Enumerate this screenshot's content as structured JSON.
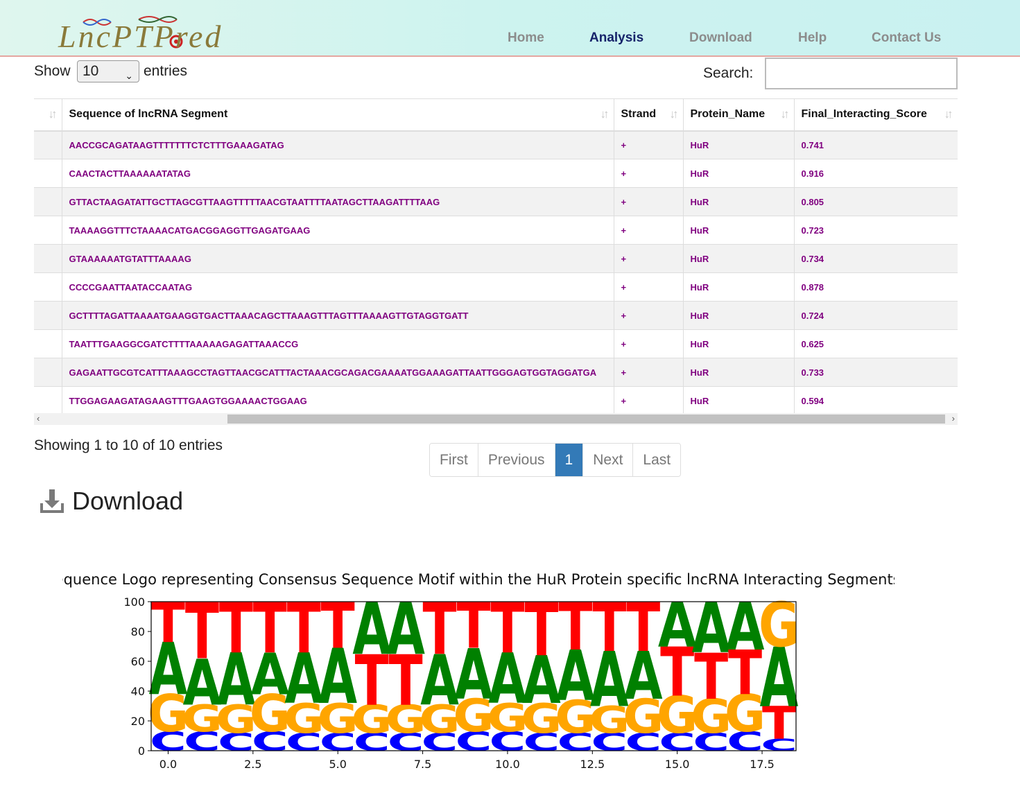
{
  "header": {
    "logo_text": "LncPTPred",
    "nav": [
      "Home",
      "Analysis",
      "Download",
      "Help",
      "Contact Us"
    ],
    "active": "Analysis"
  },
  "controls": {
    "show_label": "Show",
    "show_value": "10",
    "entries_label": "entries",
    "search_label": "Search:",
    "search_value": ""
  },
  "table": {
    "columns": [
      "Sequence of lncRNA Segment",
      "Strand",
      "Protein_Name",
      "Final_Interacting_Score"
    ],
    "rows": [
      {
        "seq": "AACCGCAGATAAGTTTTTTTCTCTTTGAAAGATAG",
        "strand": "+",
        "protein": "HuR",
        "score": "0.741"
      },
      {
        "seq": "CAACTACTTAAAAAATATAG",
        "strand": "+",
        "protein": "HuR",
        "score": "0.916"
      },
      {
        "seq": "GTTACTAAGATATTGCTTAGCGTTAAGTTTTTAACGTAATTTTAATAGCTTAAGATTTTAAG",
        "strand": "+",
        "protein": "HuR",
        "score": "0.805"
      },
      {
        "seq": "TAAAAGGTTTCTAAAACATGACGGAGGTTGAGATGAAG",
        "strand": "+",
        "protein": "HuR",
        "score": "0.723"
      },
      {
        "seq": "GTAAAAAATGTATTTAAAAG",
        "strand": "+",
        "protein": "HuR",
        "score": "0.734"
      },
      {
        "seq": "CCCCGAATTAATACCAATAG",
        "strand": "+",
        "protein": "HuR",
        "score": "0.878"
      },
      {
        "seq": "GCTTTTAGATTAAAATGAAGGTGACTTAAACAGCTTAAAGTTTAGTTTAAAAGTTGTAGGTGATT",
        "strand": "+",
        "protein": "HuR",
        "score": "0.724"
      },
      {
        "seq": "TAATTTGAAGGCGATCTTTTAAAAAGAGATTAAACCG",
        "strand": "+",
        "protein": "HuR",
        "score": "0.625"
      },
      {
        "seq": "GAGAATTGCGTCATTTAAAGCCTAGTTAACGCATTTACTAAACGCAGACGAAAATGGAAAGATTAATTGGGAGTGGTAGGATGA",
        "strand": "+",
        "protein": "HuR",
        "score": "0.733"
      },
      {
        "seq": "TTGGAGAAGATAGAAGTTTGAAGTGGAAAACTGGAAG",
        "strand": "+",
        "protein": "HuR",
        "score": "0.594"
      }
    ]
  },
  "footer": {
    "info": "Showing 1 to 10 of 10 entries",
    "pager": [
      "First",
      "Previous",
      "1",
      "Next",
      "Last"
    ],
    "current_page": "1",
    "download_label": "Download"
  },
  "chart_data": {
    "type": "sequence-logo",
    "title": "Sequence Logo representing Consensus Sequence Motif within the HuR Protein specific lncRNA Interacting Segments",
    "xlabel": "",
    "ylabel": "",
    "ylim": [
      0,
      100
    ],
    "yticks": [
      0,
      20,
      40,
      60,
      80,
      100
    ],
    "xticks": [
      0.0,
      2.5,
      5.0,
      7.5,
      10.0,
      12.5,
      15.0,
      17.5
    ],
    "xtick_labels": [
      "0.0",
      "2.5",
      "5.0",
      "7.5",
      "10.0",
      "12.5",
      "15.0",
      "17.5"
    ],
    "colors": {
      "C": "#0000ff",
      "G": "#ffa500",
      "A": "#008000",
      "T": "#ff0000"
    },
    "positions": [
      {
        "x": 0,
        "stack": [
          [
            "C",
            13
          ],
          [
            "G",
            25
          ],
          [
            "A",
            35
          ],
          [
            "T",
            27
          ]
        ]
      },
      {
        "x": 1,
        "stack": [
          [
            "C",
            13
          ],
          [
            "G",
            18
          ],
          [
            "A",
            31
          ],
          [
            "T",
            38
          ]
        ]
      },
      {
        "x": 2,
        "stack": [
          [
            "C",
            12
          ],
          [
            "G",
            19
          ],
          [
            "A",
            35
          ],
          [
            "T",
            34
          ]
        ]
      },
      {
        "x": 3,
        "stack": [
          [
            "C",
            13
          ],
          [
            "G",
            25
          ],
          [
            "A",
            28
          ],
          [
            "T",
            34
          ]
        ]
      },
      {
        "x": 4,
        "stack": [
          [
            "C",
            12
          ],
          [
            "G",
            20
          ],
          [
            "A",
            34
          ],
          [
            "T",
            34
          ]
        ]
      },
      {
        "x": 5,
        "stack": [
          [
            "C",
            12
          ],
          [
            "G",
            20
          ],
          [
            "A",
            37
          ],
          [
            "T",
            31
          ]
        ]
      },
      {
        "x": 6,
        "stack": [
          [
            "C",
            12
          ],
          [
            "G",
            19
          ],
          [
            "T",
            34
          ],
          [
            "A",
            35
          ]
        ]
      },
      {
        "x": 7,
        "stack": [
          [
            "C",
            12
          ],
          [
            "G",
            19
          ],
          [
            "T",
            34
          ],
          [
            "A",
            35
          ]
        ]
      },
      {
        "x": 8,
        "stack": [
          [
            "C",
            12
          ],
          [
            "G",
            19
          ],
          [
            "A",
            34
          ],
          [
            "T",
            35
          ]
        ]
      },
      {
        "x": 9,
        "stack": [
          [
            "C",
            13
          ],
          [
            "G",
            22
          ],
          [
            "A",
            34
          ],
          [
            "T",
            31
          ]
        ]
      },
      {
        "x": 10,
        "stack": [
          [
            "C",
            13
          ],
          [
            "G",
            19
          ],
          [
            "A",
            34
          ],
          [
            "T",
            34
          ]
        ]
      },
      {
        "x": 11,
        "stack": [
          [
            "C",
            12
          ],
          [
            "G",
            20
          ],
          [
            "A",
            32
          ],
          [
            "T",
            36
          ]
        ]
      },
      {
        "x": 12,
        "stack": [
          [
            "C",
            12
          ],
          [
            "G",
            22
          ],
          [
            "A",
            34
          ],
          [
            "T",
            32
          ]
        ]
      },
      {
        "x": 13,
        "stack": [
          [
            "C",
            12
          ],
          [
            "G",
            18
          ],
          [
            "A",
            37
          ],
          [
            "T",
            33
          ]
        ]
      },
      {
        "x": 14,
        "stack": [
          [
            "C",
            12
          ],
          [
            "G",
            23
          ],
          [
            "A",
            32
          ],
          [
            "T",
            33
          ]
        ]
      },
      {
        "x": 15,
        "stack": [
          [
            "C",
            12
          ],
          [
            "G",
            25
          ],
          [
            "T",
            33
          ],
          [
            "A",
            30
          ]
        ]
      },
      {
        "x": 16,
        "stack": [
          [
            "C",
            12
          ],
          [
            "G",
            23
          ],
          [
            "T",
            31
          ],
          [
            "A",
            34
          ]
        ]
      },
      {
        "x": 17,
        "stack": [
          [
            "C",
            13
          ],
          [
            "G",
            25
          ],
          [
            "T",
            30
          ],
          [
            "A",
            32
          ]
        ]
      },
      {
        "x": 18,
        "stack": [
          [
            "C",
            8
          ],
          [
            "T",
            22
          ],
          [
            "A",
            40
          ],
          [
            "G",
            30
          ]
        ]
      }
    ]
  }
}
